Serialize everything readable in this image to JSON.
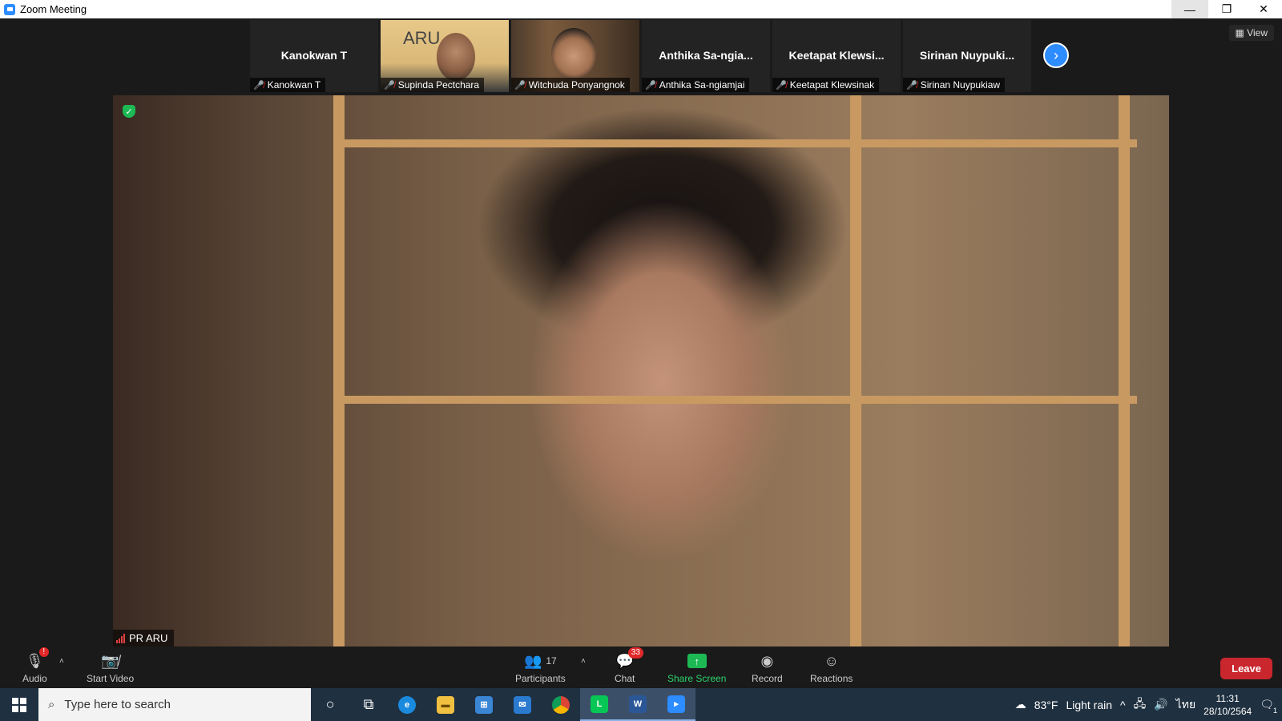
{
  "window": {
    "title": "Zoom Meeting",
    "minimize": "—",
    "restore": "❐",
    "close": "✕"
  },
  "gallery": {
    "view_label": "View",
    "tiles": [
      {
        "display_name": "Kanokwan T",
        "label": "Kanokwan T",
        "has_video": false
      },
      {
        "display_name": "",
        "label": "Supinda Pectchara",
        "has_video": true,
        "overlay_text": "ARU"
      },
      {
        "display_name": "",
        "label": "Witchuda Ponyangnok",
        "has_video": true
      },
      {
        "display_name": "Anthika Sa-ngia...",
        "label": "Anthika Sa-ngiamjai",
        "has_video": false
      },
      {
        "display_name": "Keetapat Klewsi...",
        "label": "Keetapat Klewsinak",
        "has_video": false
      },
      {
        "display_name": "Sirinan Nuypuki...",
        "label": "Sirinan Nuypukiaw",
        "has_video": false
      }
    ],
    "next_icon": "chevron-right"
  },
  "main_video": {
    "speaker_label": "PR ARU"
  },
  "controls": {
    "audio_label": "Audio",
    "audio_badge": "!",
    "start_video_label": "Start Video",
    "participants_label": "Participants",
    "participants_count": "17",
    "chat_label": "Chat",
    "chat_badge": "33",
    "share_label": "Share Screen",
    "record_label": "Record",
    "reactions_label": "Reactions",
    "leave_label": "Leave",
    "accent_color": "#2D8CFF",
    "leave_color": "#C9262E",
    "share_color": "#2BD46B"
  },
  "taskbar": {
    "search_placeholder": "Type here to search",
    "weather_temp": "83°F",
    "weather_text": "Light rain",
    "input_lang": "ไทย",
    "time": "11:31",
    "date": "28/10/2564",
    "notification_count": "1"
  }
}
